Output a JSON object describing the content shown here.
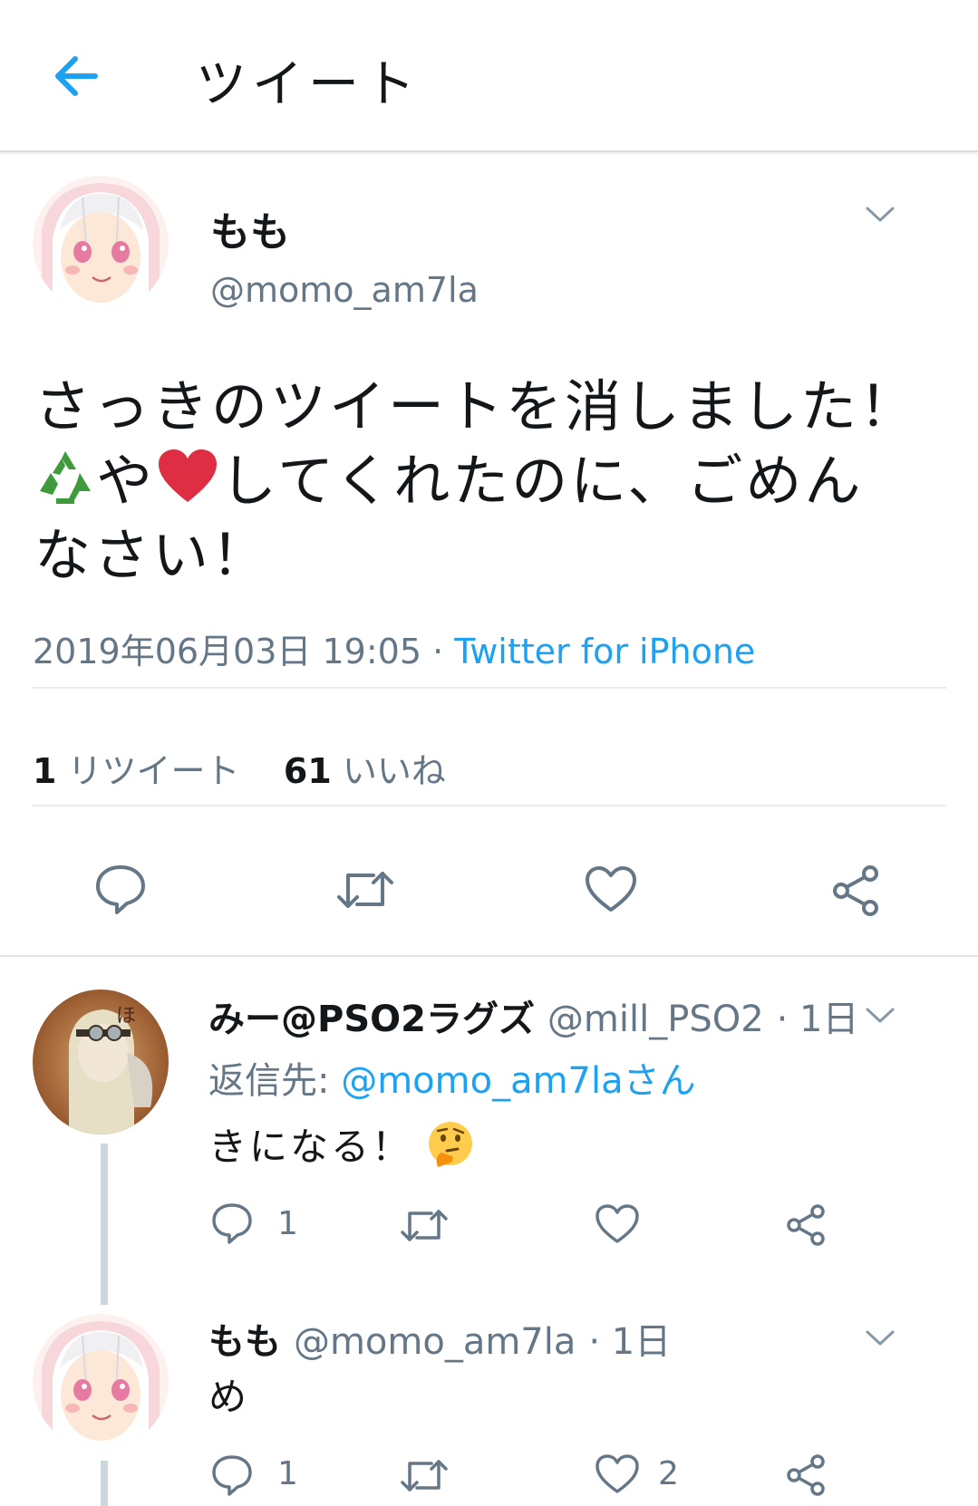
{
  "header": {
    "title": "ツイート",
    "back_icon": "back-arrow-icon",
    "accent": "#1da1f2"
  },
  "main_tweet": {
    "name": "もも",
    "handle": "@momo_am7la",
    "text_line1": "さっきのツイートを消しました！",
    "text_line2_after_recycle": "や",
    "text_line2_after_heart": "してくれたのに、ごめん",
    "text_line3": "なさい！",
    "timestamp": "2019年06月03日 19:05",
    "separator": " · ",
    "source": "Twitter for iPhone",
    "retweet_count": "1",
    "retweet_label": "リツイート",
    "like_count": "61",
    "like_label": "いいね"
  },
  "replies": [
    {
      "name": "みー@PSO2ラグズ",
      "handle": "@mill_PSO2",
      "time": "· 1日",
      "reply_to_label": "返信先: ",
      "reply_to_handle": "@momo_am7laさん",
      "text": "きになる！",
      "reply_count": "1",
      "like_count": ""
    },
    {
      "name": "もも",
      "handle": "@momo_am7la",
      "time": "· 1日",
      "text": "め",
      "reply_count": "1",
      "like_count": "2"
    }
  ]
}
